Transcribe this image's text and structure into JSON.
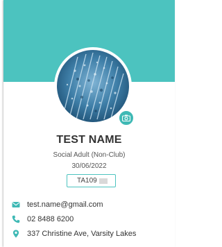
{
  "profile": {
    "name": "TEST NAME",
    "membership_type": "Social Adult (Non-Club)",
    "date": "30/06/2022",
    "member_id": "TA109"
  },
  "contact": {
    "email": "test.name@gmail.com",
    "phone": "02 8488 6200",
    "address": "337 Christine Ave, Varsity Lakes"
  },
  "icons": {
    "email": "envelope-icon",
    "phone": "phone-icon",
    "address": "map-marker-icon",
    "avatar_upload": "camera-icon"
  },
  "colors": {
    "accent": "#4cc3bf",
    "icon": "#3fb9b5",
    "text": "#333333"
  }
}
